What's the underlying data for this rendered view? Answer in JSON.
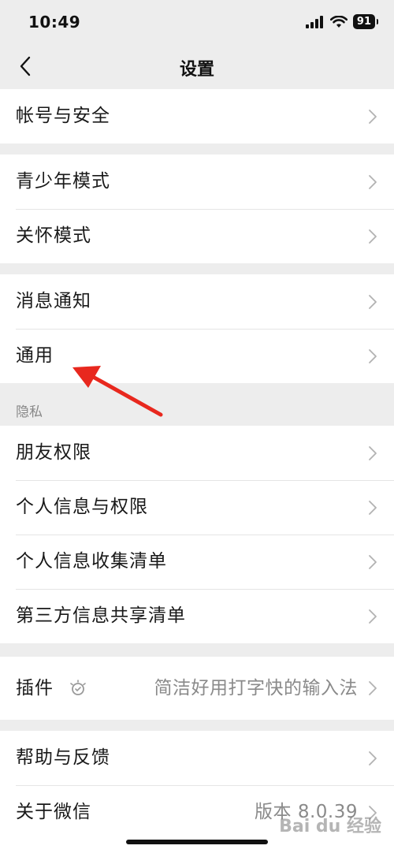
{
  "status_bar": {
    "time": "10:49",
    "battery": "91"
  },
  "nav": {
    "title": "设置"
  },
  "groups": {
    "account": [
      "帐号与安全"
    ],
    "modes": [
      "青少年模式",
      "关怀模式"
    ],
    "general": [
      "消息通知",
      "通用"
    ],
    "privacy_header": "隐私",
    "privacy": [
      "朋友权限",
      "个人信息与权限",
      "个人信息收集清单",
      "第三方信息共享清单"
    ],
    "plugin": {
      "label": "插件",
      "value": "简洁好用打字快的输入法"
    },
    "about": {
      "help": "帮助与反馈",
      "about_label": "关于微信",
      "version": "版本 8.0.39"
    }
  },
  "watermark": "Bai du 经验",
  "colors": {
    "background": "#ededed",
    "arrow": "#e8281e"
  }
}
